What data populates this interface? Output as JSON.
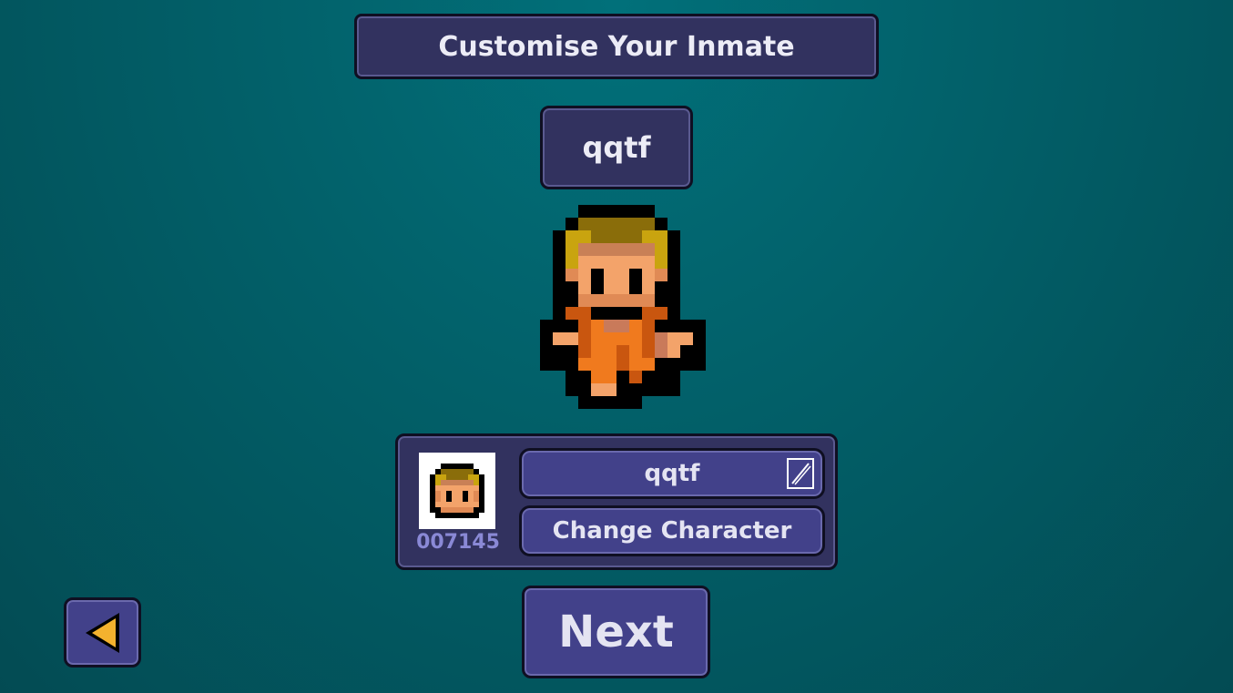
{
  "header": {
    "title": "Customise Your Inmate"
  },
  "character": {
    "name": "qqtf",
    "inmate_id": "007145"
  },
  "name_field": {
    "value": "qqtf"
  },
  "actions": {
    "change_character": "Change Character",
    "next": "Next"
  },
  "icons": {
    "back": "back-arrow-icon",
    "edit": "pencil-edit-icon"
  },
  "colors": {
    "panel": "#32325f",
    "button": "#42418a",
    "background": "#025f68",
    "arrow": "#f4b22e",
    "id_text": "#8a89d6"
  }
}
